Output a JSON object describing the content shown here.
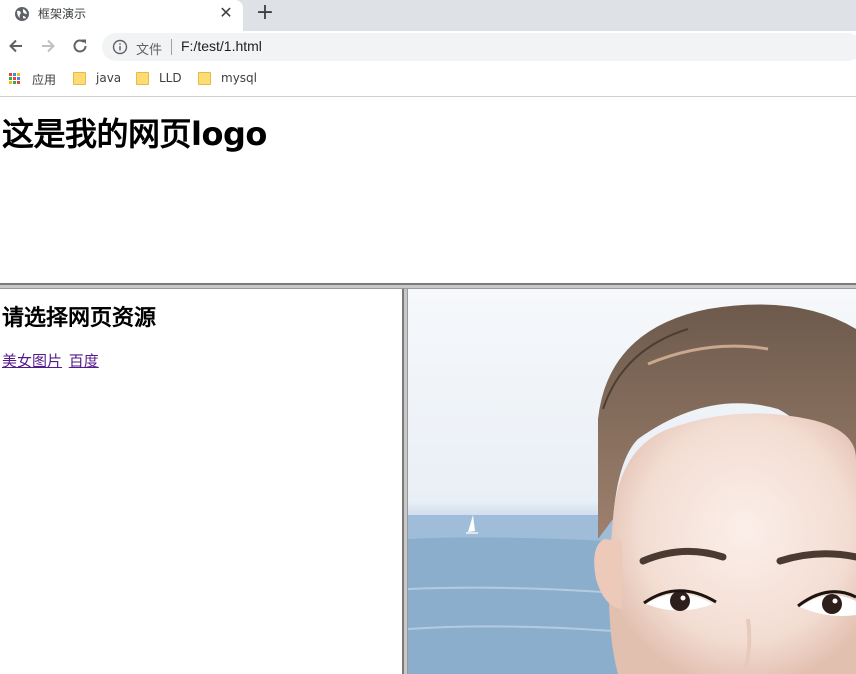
{
  "browser": {
    "tab_title": "框架演示",
    "new_tab_label": "+",
    "close_label": "✕",
    "scheme_label": "文件",
    "url": "F:/test/1.html",
    "bookmarks": [
      {
        "label": "应用",
        "icon": "apps-grid-icon"
      },
      {
        "label": "java",
        "icon": "folder-icon"
      },
      {
        "label": "LLD",
        "icon": "folder-icon"
      },
      {
        "label": "mysql",
        "icon": "folder-icon"
      }
    ]
  },
  "page": {
    "logo_heading": "这是我的网页logo",
    "nav_heading": "请选择网页资源",
    "links": [
      "美女图片",
      "百度"
    ],
    "link_color": "#551a8b"
  },
  "content_frame": {
    "image": "portrait photo of a woman by the sea"
  }
}
